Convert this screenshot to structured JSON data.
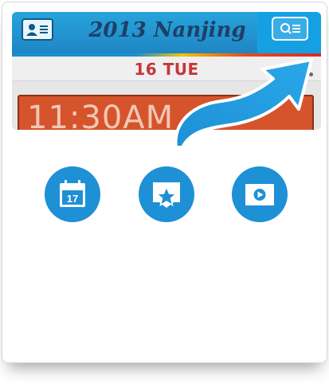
{
  "app": {
    "title": "2013 Nanjing"
  },
  "date_bar": {
    "date_label": "16 TUE"
  },
  "event": {
    "time_label": "11:30AM"
  },
  "calendar_icon": {
    "day_number": "17"
  },
  "colors": {
    "accent_blue": "#1e90d6",
    "header_blue": "#27a4dc",
    "date_red": "#c9353a",
    "event_orange": "#d5542c"
  },
  "icons": {
    "profile": "contact-card-icon",
    "search": "search-list-icon",
    "calendar": "calendar-icon",
    "favorites": "star-board-icon",
    "video": "video-play-icon",
    "pointer": "curved-arrow-icon"
  }
}
